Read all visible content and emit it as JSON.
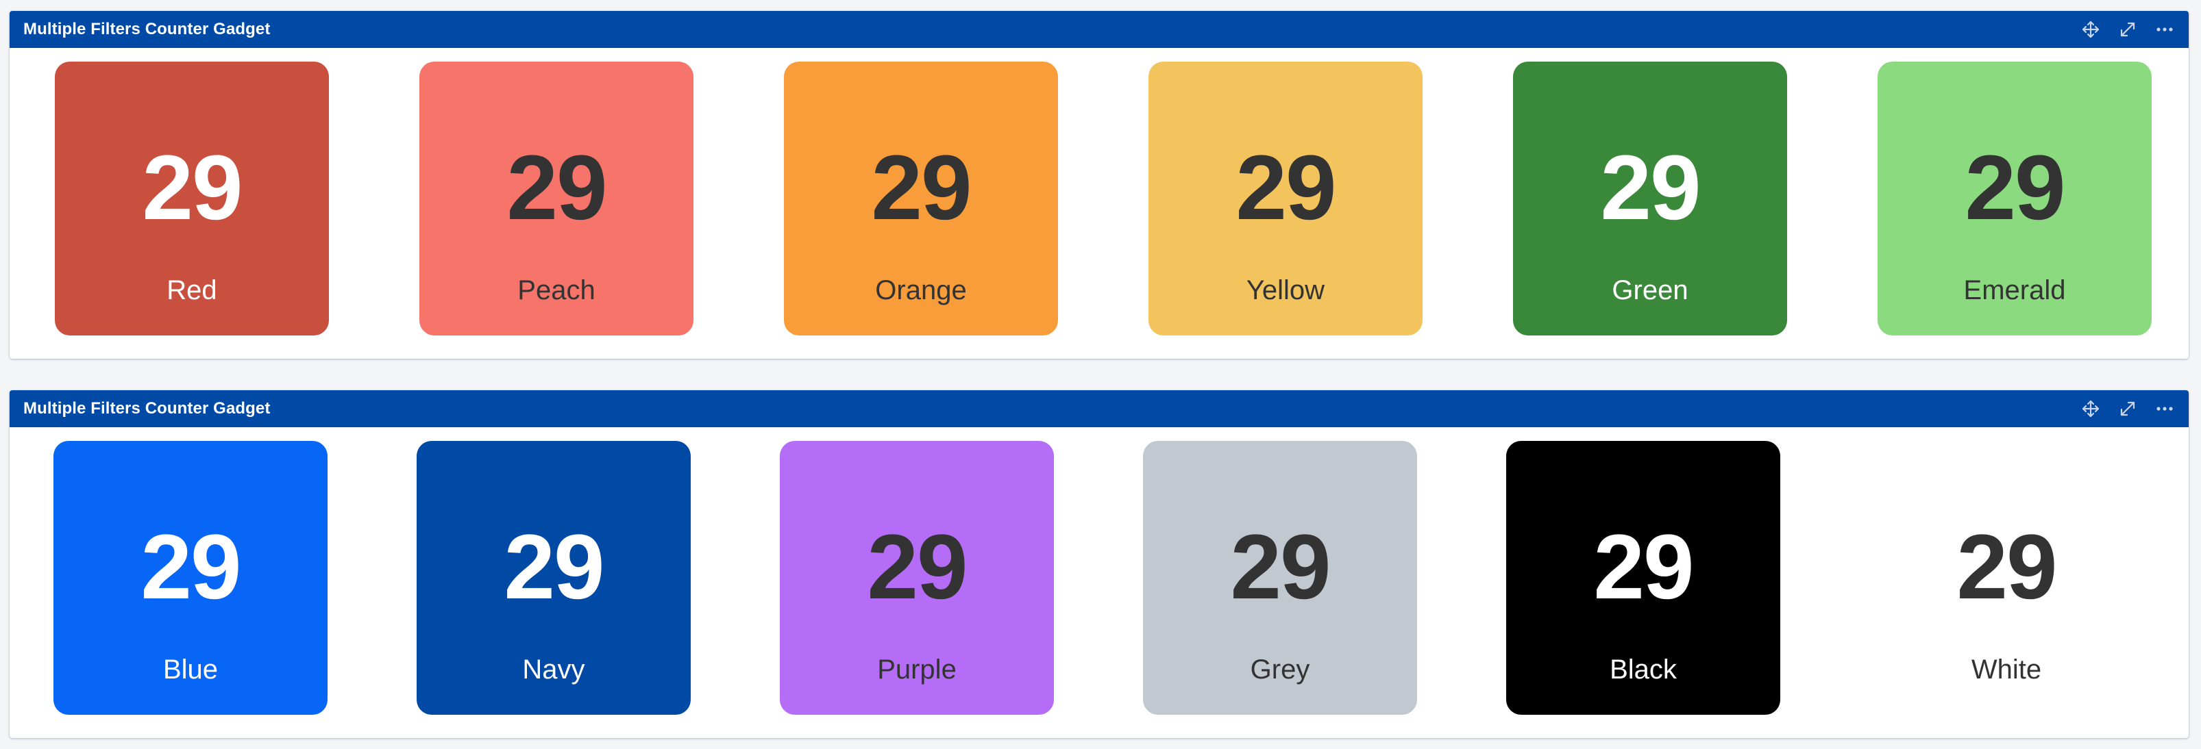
{
  "gadgets": [
    {
      "title": "Multiple Filters Counter Gadget",
      "tiles": [
        {
          "count": "29",
          "label": "Red",
          "bg": "#c94f3e",
          "fg": "#ffffff"
        },
        {
          "count": "29",
          "label": "Peach",
          "bg": "#f6746a",
          "fg": "#333333"
        },
        {
          "count": "29",
          "label": "Orange",
          "bg": "#f99d3b",
          "fg": "#333333"
        },
        {
          "count": "29",
          "label": "Yellow",
          "bg": "#f3c45d",
          "fg": "#333333"
        },
        {
          "count": "29",
          "label": "Green",
          "bg": "#3a893b",
          "fg": "#ffffff"
        },
        {
          "count": "29",
          "label": "Emerald",
          "bg": "#8bda80",
          "fg": "#333333"
        }
      ]
    },
    {
      "title": "Multiple Filters Counter Gadget",
      "tiles": [
        {
          "count": "29",
          "label": "Blue",
          "bg": "#0766f5",
          "fg": "#ffffff"
        },
        {
          "count": "29",
          "label": "Navy",
          "bg": "#0049a5",
          "fg": "#ffffff"
        },
        {
          "count": "29",
          "label": "Purple",
          "bg": "#b56cf6",
          "fg": "#333333"
        },
        {
          "count": "29",
          "label": "Grey",
          "bg": "#c2c8d0",
          "fg": "#333333"
        },
        {
          "count": "29",
          "label": "Black",
          "bg": "#000000",
          "fg": "#ffffff"
        },
        {
          "count": "29",
          "label": "White",
          "bg": "#ffffff",
          "fg": "#333333"
        }
      ]
    }
  ],
  "icons": {
    "move": "move-icon",
    "expand": "expand-icon",
    "more": "more-icon"
  }
}
